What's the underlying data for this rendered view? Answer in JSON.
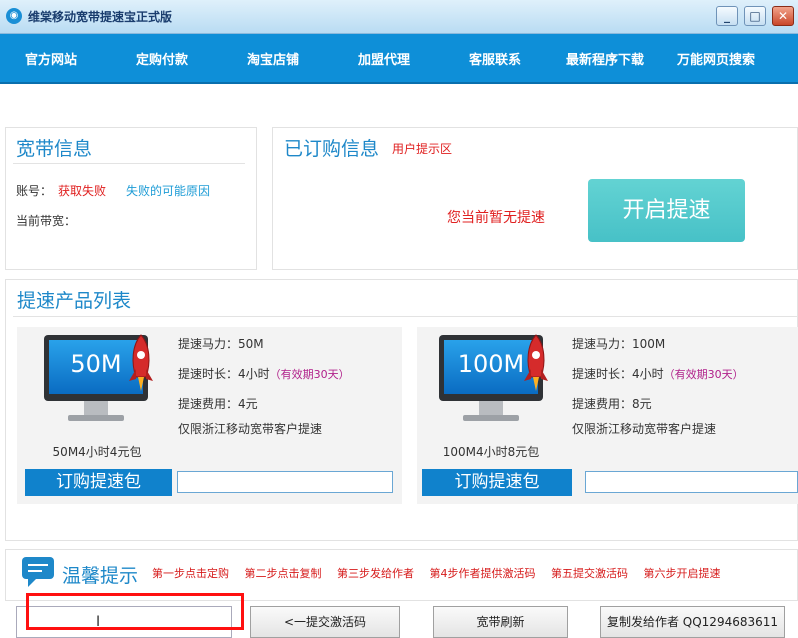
{
  "window": {
    "title": "维棠移动宽带提速宝正式版",
    "minimize": "_",
    "maximize": "□",
    "close": "✕"
  },
  "nav": [
    "官方网站",
    "定购付款",
    "淘宝店铺",
    "加盟代理",
    "客服联系",
    "最新程序下载",
    "万能网页搜索"
  ],
  "broadband": {
    "title": "宽带信息",
    "account_label": "账号：",
    "account_value": "获取失败",
    "fail_link": "失败的可能原因",
    "bandwidth_label": "当前带宽："
  },
  "ordered": {
    "title": "已订购信息",
    "hint": "用户提示区",
    "status": "您当前暂无提速",
    "start_button": "开启提速"
  },
  "products": {
    "title": "提速产品列表",
    "items": [
      {
        "screen": "50M",
        "name": "50M4小时4元包",
        "power": "提速马力：50M",
        "duration": "提速时长：4小时",
        "validity": "（有效期30天）",
        "fee": "提速费用：4元",
        "limit": "仅限浙江移动宽带客户提速",
        "buy": "订购提速包"
      },
      {
        "screen": "100M",
        "name": "100M4小时8元包",
        "power": "提速马力：100M",
        "duration": "提速时长：4小时",
        "validity": "（有效期30天）",
        "fee": "提速费用：8元",
        "limit": "仅限浙江移动宽带客户提速",
        "buy": "订购提速包"
      }
    ]
  },
  "tips": {
    "title": "温馨提示",
    "steps": [
      "第一步点击定购",
      "第二步点击复制",
      "第三步发给作者",
      "第4步作者提供激活码",
      "第五提交激活码",
      "第六步开启提速"
    ]
  },
  "bottom": {
    "caret": "I",
    "submit": "<一提交激活码",
    "refresh": "宽带刷新",
    "copy": "复制发给作者  QQ1294683611"
  },
  "colors": {
    "nav_bg": "#0e8fd8",
    "accent": "#1e88c9",
    "error": "#e02020",
    "start_btn": "#4cc6cb",
    "buy_btn": "#1082cc",
    "highlight": "#ff1010"
  }
}
